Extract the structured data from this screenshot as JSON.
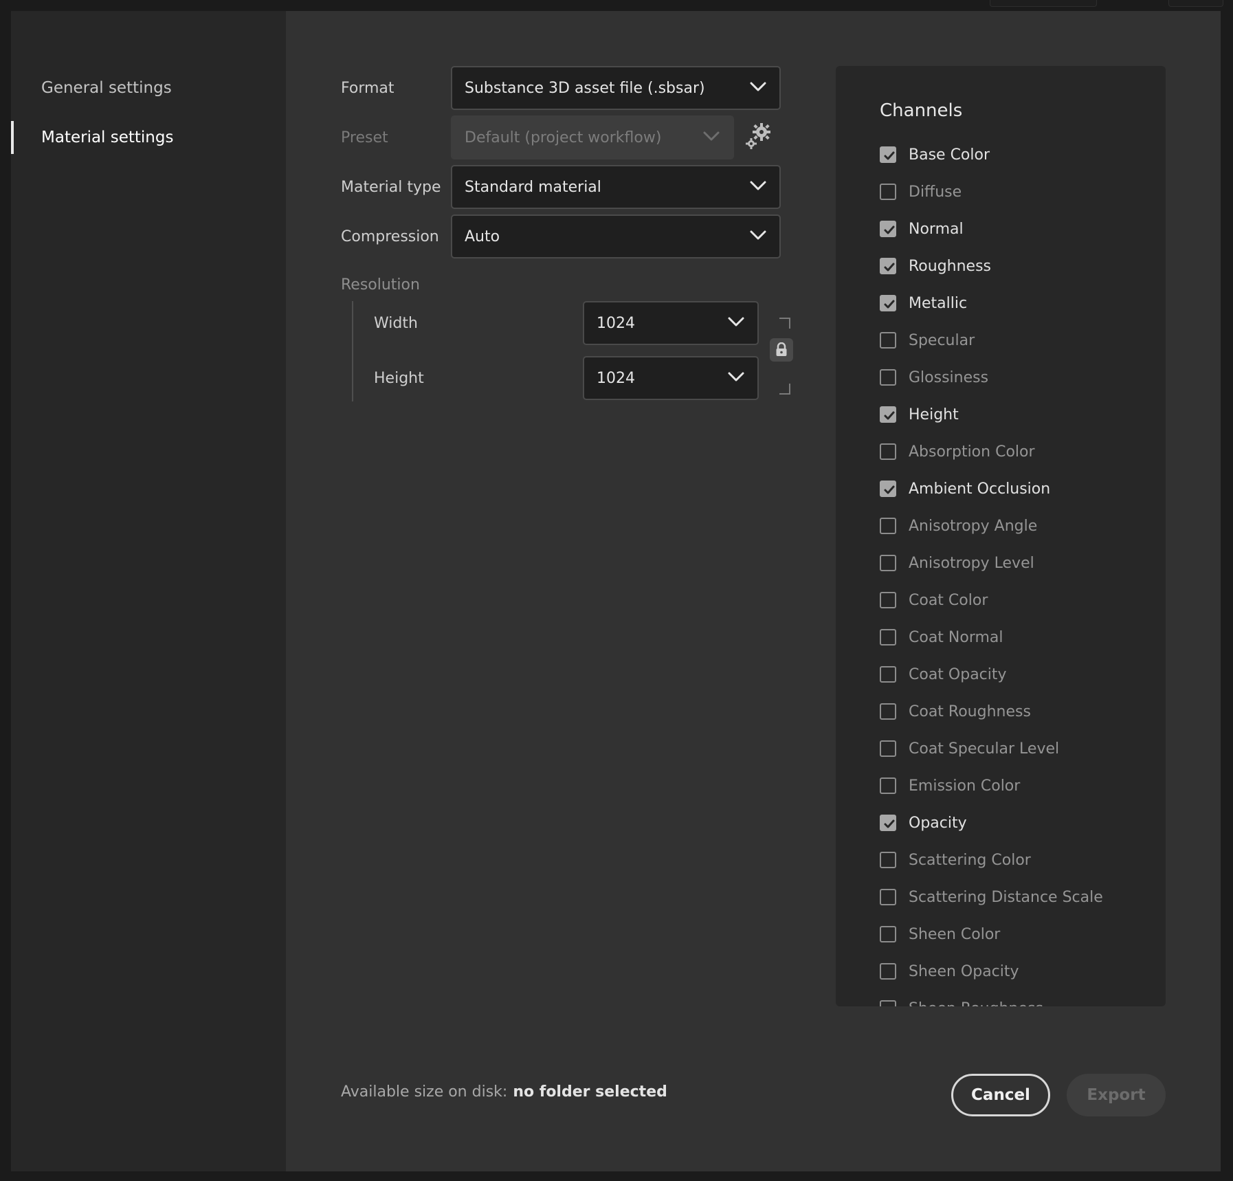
{
  "sidebar": {
    "items": [
      {
        "label": "General settings",
        "active": false
      },
      {
        "label": "Material settings",
        "active": true
      }
    ]
  },
  "form": {
    "format": {
      "label": "Format",
      "value": "Substance 3D asset file (.sbsar)"
    },
    "preset": {
      "label": "Preset",
      "value": "Default (project workflow)",
      "disabled": true
    },
    "material_type": {
      "label": "Material type",
      "value": "Standard material"
    },
    "compression": {
      "label": "Compression",
      "value": "Auto"
    },
    "resolution": {
      "label": "Resolution",
      "width": {
        "label": "Width",
        "value": "1024"
      },
      "height": {
        "label": "Height",
        "value": "1024"
      },
      "locked": true
    }
  },
  "channels": {
    "title": "Channels",
    "items": [
      {
        "label": "Base Color",
        "checked": true
      },
      {
        "label": "Diffuse",
        "checked": false
      },
      {
        "label": "Normal",
        "checked": true
      },
      {
        "label": "Roughness",
        "checked": true
      },
      {
        "label": "Metallic",
        "checked": true
      },
      {
        "label": "Specular",
        "checked": false
      },
      {
        "label": "Glossiness",
        "checked": false
      },
      {
        "label": "Height",
        "checked": true
      },
      {
        "label": "Absorption Color",
        "checked": false
      },
      {
        "label": "Ambient Occlusion",
        "checked": true
      },
      {
        "label": "Anisotropy Angle",
        "checked": false
      },
      {
        "label": "Anisotropy Level",
        "checked": false
      },
      {
        "label": "Coat Color",
        "checked": false
      },
      {
        "label": "Coat Normal",
        "checked": false
      },
      {
        "label": "Coat Opacity",
        "checked": false
      },
      {
        "label": "Coat Roughness",
        "checked": false
      },
      {
        "label": "Coat Specular Level",
        "checked": false
      },
      {
        "label": "Emission Color",
        "checked": false
      },
      {
        "label": "Opacity",
        "checked": true
      },
      {
        "label": "Scattering Color",
        "checked": false
      },
      {
        "label": "Scattering Distance Scale",
        "checked": false
      },
      {
        "label": "Sheen Color",
        "checked": false
      },
      {
        "label": "Sheen Opacity",
        "checked": false
      },
      {
        "label": "Sheen Roughness",
        "checked": false
      }
    ]
  },
  "footer": {
    "disk_label": "Available size on disk:",
    "disk_value": "no folder selected",
    "cancel_label": "Cancel",
    "export_label": "Export",
    "export_disabled": true
  },
  "icons": {
    "dropdown": "chevron-down-icon",
    "preset_settings": "gear-icon",
    "resolution_lock": "lock-icon",
    "checkbox_checked": "checkmark-icon"
  },
  "colors": {
    "window_bg": "#323232",
    "sidebar_bg": "#272727",
    "panel_bg": "#272727",
    "field_bg": "#1f1f1f",
    "checkbox_checked": "#a8a8a8"
  }
}
